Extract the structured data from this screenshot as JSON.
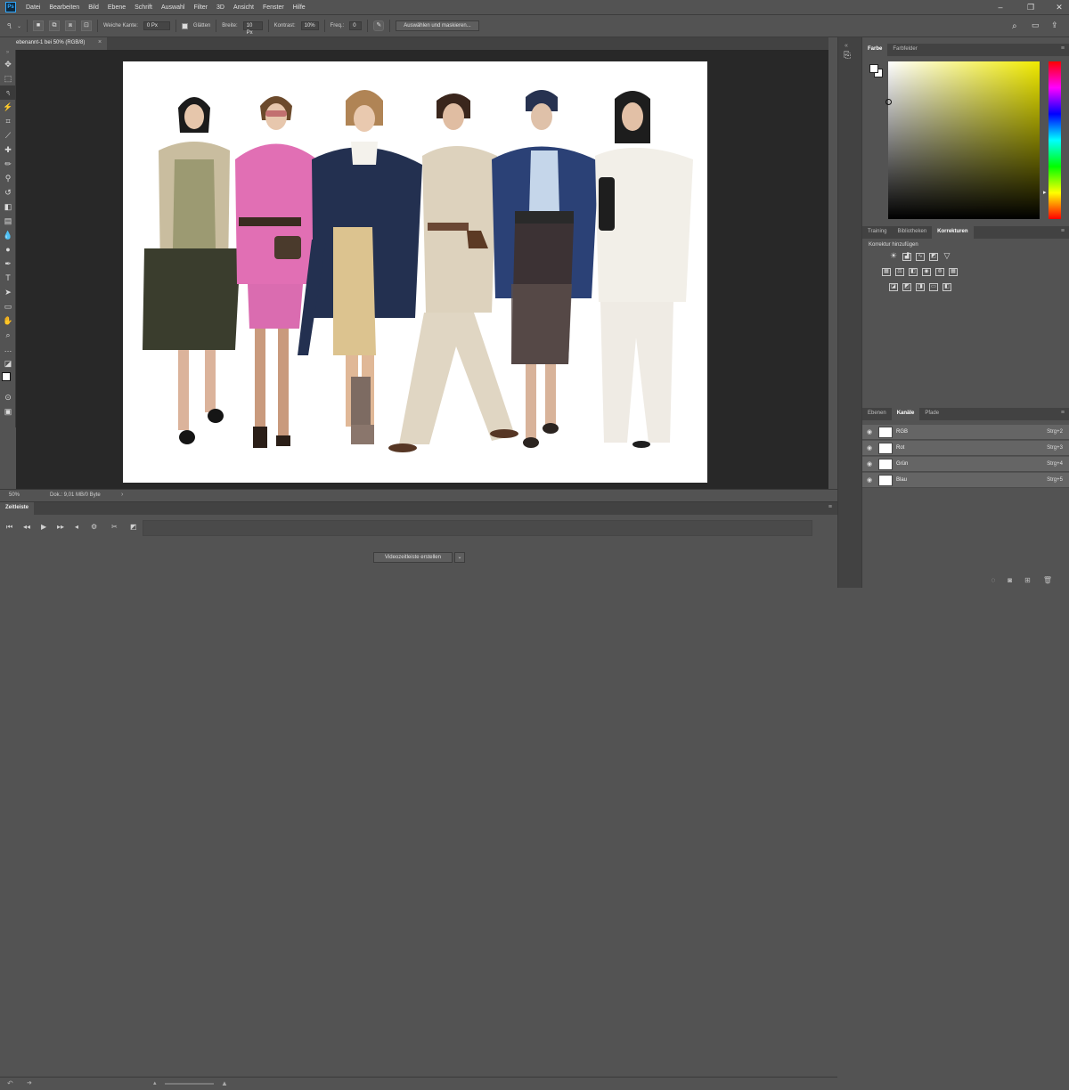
{
  "menubar": {
    "logo": "Ps",
    "items": [
      "Datei",
      "Bearbeiten",
      "Bild",
      "Ebene",
      "Schrift",
      "Auswahl",
      "Filter",
      "3D",
      "Ansicht",
      "Fenster",
      "Hilfe"
    ],
    "window_controls": [
      "minimize-icon",
      "maximize-icon",
      "close-icon"
    ]
  },
  "options": {
    "feather_label": "Weiche Kante:",
    "feather_value": "0 Px",
    "antialias_label": "Glätten",
    "width_label": "Breite:",
    "width_value": "10 Px",
    "contrast_label": "Kontrast:",
    "contrast_value": "10%",
    "frequency_label": "Freq.:",
    "frequency_value": "0",
    "select_mask_button": "Auswählen und maskieren..."
  },
  "document": {
    "tab_title": "ebenannt-1 bei 50% (RGB/8)",
    "close": "×",
    "zoom": "50%",
    "doc_info": "Dok.: 9,01 MB/0 Byte"
  },
  "timeline": {
    "tab": "Zeitleiste",
    "create_button": "Videozeitleiste erstellen"
  },
  "color_panel": {
    "tabs": [
      "Farbe",
      "Farbfelder"
    ],
    "active_tab": "Farbe",
    "hue": "yellow",
    "foreground": "#ffffff",
    "background": "#ffffff"
  },
  "adjustments_panel": {
    "tabs": [
      "Training",
      "Bibliotheken",
      "Korrekturen"
    ],
    "active_tab": "Korrekturen",
    "add_label": "Korrektur hinzufügen"
  },
  "channels_panel": {
    "tabs": [
      "Ebenen",
      "Kanäle",
      "Pfade"
    ],
    "active_tab": "Kanäle",
    "channels": [
      {
        "name": "RGB",
        "shortcut": "Strg+2"
      },
      {
        "name": "Rot",
        "shortcut": "Strg+3"
      },
      {
        "name": "Grün",
        "shortcut": "Strg+4"
      },
      {
        "name": "Blau",
        "shortcut": "Strg+5"
      }
    ]
  },
  "colors": {
    "app_bg": "#535353",
    "canvas_bg": "#282828",
    "panel_tab_bg": "#424242",
    "accent": "#31a8ff"
  }
}
